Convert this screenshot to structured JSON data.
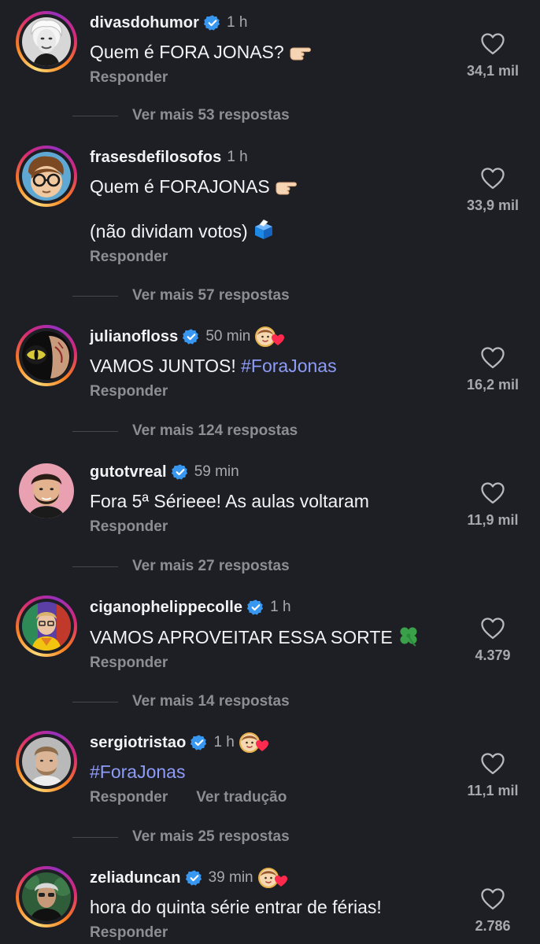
{
  "ui": {
    "reply_label": "Responder",
    "translate_label": "Ver tradução"
  },
  "colors": {
    "background": "#1e1f24",
    "hashtag": "#8c9cf7",
    "verified": "#3897f0",
    "muted": "#8d8e92"
  },
  "comments": [
    {
      "username": "divasdohumor",
      "verified": true,
      "time": "1 h",
      "text": "Quem é FORA JONAS?",
      "emoji": "pointing-right-icon",
      "likes": "34,1 mil",
      "more_replies": "Ver mais 53 respostas"
    },
    {
      "username": "frasesdefilosofos",
      "verified": false,
      "time": "1 h",
      "text": "Quem é FORAJONAS",
      "emoji": "pointing-right-icon",
      "text2": "(não dividam votos)",
      "emoji2": "ballot-box-icon",
      "likes": "33,9 mil",
      "more_replies": "Ver mais 57 respostas"
    },
    {
      "username": "julianofloss",
      "verified": true,
      "time": "50 min",
      "liked_by_author": true,
      "text_prefix": "VAMOS JUNTOS!",
      "hashtag": "#ForaJonas",
      "likes": "16,2 mil",
      "more_replies": "Ver mais 124 respostas"
    },
    {
      "username": "gutotvreal",
      "verified": true,
      "time": "59 min",
      "text": "Fora 5ª Sérieee! As aulas voltaram",
      "likes": "11,9 mil",
      "more_replies": "Ver mais 27 respostas"
    },
    {
      "username": "ciganophelippecolle",
      "verified": true,
      "time": "1 h",
      "text": "VAMOS APROVEITAR ESSA SORTE",
      "emoji": "four-leaf-clover-icon",
      "likes": "4.379",
      "more_replies": "Ver mais 14 respostas"
    },
    {
      "username": "sergiotristao",
      "verified": true,
      "time": "1 h",
      "liked_by_author": true,
      "hashtag": "#ForaJonas",
      "likes": "11,1 mil",
      "show_translate": true,
      "more_replies": "Ver mais 25 respostas"
    },
    {
      "username": "zeliaduncan",
      "verified": true,
      "time": "39 min",
      "liked_by_author": true,
      "text": "hora do quinta série entrar de férias!",
      "likes": "2.786"
    }
  ]
}
